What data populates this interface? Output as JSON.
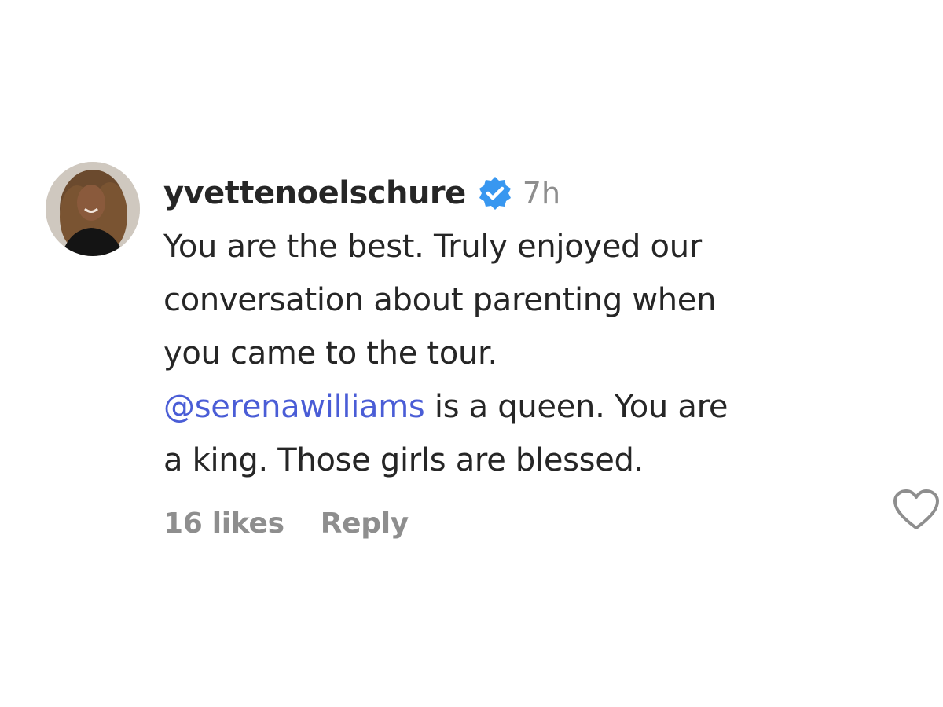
{
  "comment": {
    "username": "yvettenoelschure",
    "verified_icon": "verified-badge-icon",
    "time": "7h",
    "text_lines": [
      "You are the best. Truly enjoyed our",
      "conversation about parenting when",
      "you came to the tour."
    ],
    "mention": "@serenawilliams",
    "after_mention": " is a queen. You are",
    "last_line": "a king. Those girls are blessed.",
    "likes": "16 likes",
    "reply_label": "Reply",
    "like_icon": "heart-outline-icon",
    "colors": {
      "mention": "#4a5dd6",
      "verified": "#3897f0",
      "secondary_text": "#8e8e8e",
      "primary_text": "#262626"
    }
  }
}
